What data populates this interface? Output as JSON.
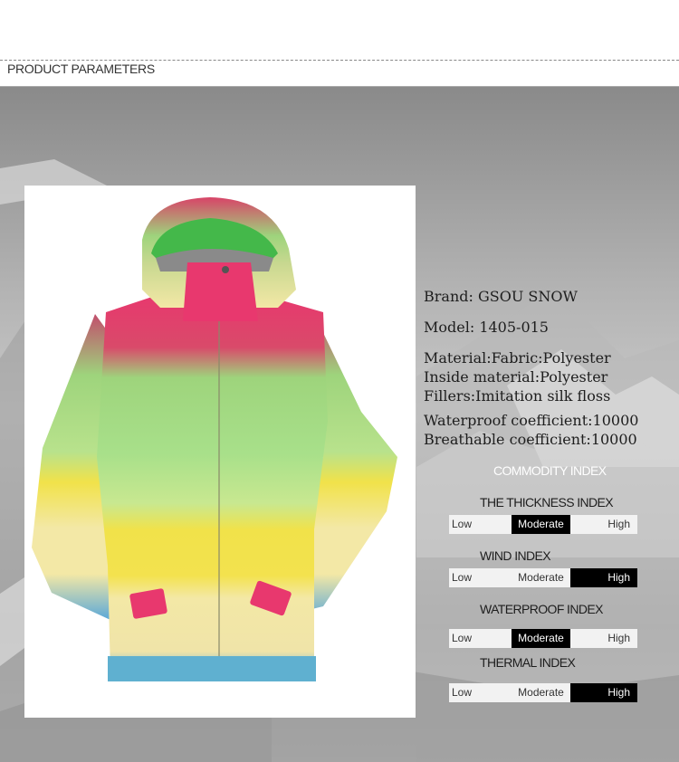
{
  "section_title": "PRODUCT PARAMETERS",
  "specs": {
    "brand": "Brand:   GSOU SNOW",
    "model": "Model:   1405-015",
    "material": "Material:Fabric:Polyester",
    "inside_material": "Inside material:Polyester",
    "fillers": "Fillers:Imitation silk floss",
    "waterproof": "Waterproof coefficient:10000",
    "breathable": "Breathable coefficient:10000"
  },
  "index_title": "COMMODITY INDEX",
  "indices": [
    {
      "label": "THE THICKNESS INDEX",
      "low": "Low",
      "moderate": "Moderate",
      "high": "High",
      "selected": "Moderate"
    },
    {
      "label": "WIND INDEX",
      "low": "Low",
      "moderate": "Moderate",
      "high": "High",
      "selected": "High"
    },
    {
      "label": "WATERPROOF INDEX",
      "low": "Low",
      "moderate": "Moderate",
      "high": "High",
      "selected": "Moderate"
    },
    {
      "label": "THERMAL INDEX",
      "low": "Low",
      "moderate": "Moderate",
      "high": "High",
      "selected": "High"
    }
  ],
  "colors": {
    "selected_segment": "#000000",
    "unselected_segment": "#f2f2f2",
    "jacket_pink": "#e8386e",
    "jacket_green": "#9fe07a",
    "jacket_yellow": "#f1e24a",
    "jacket_cream": "#f3e8a6",
    "jacket_blue": "#5aa8d8"
  }
}
